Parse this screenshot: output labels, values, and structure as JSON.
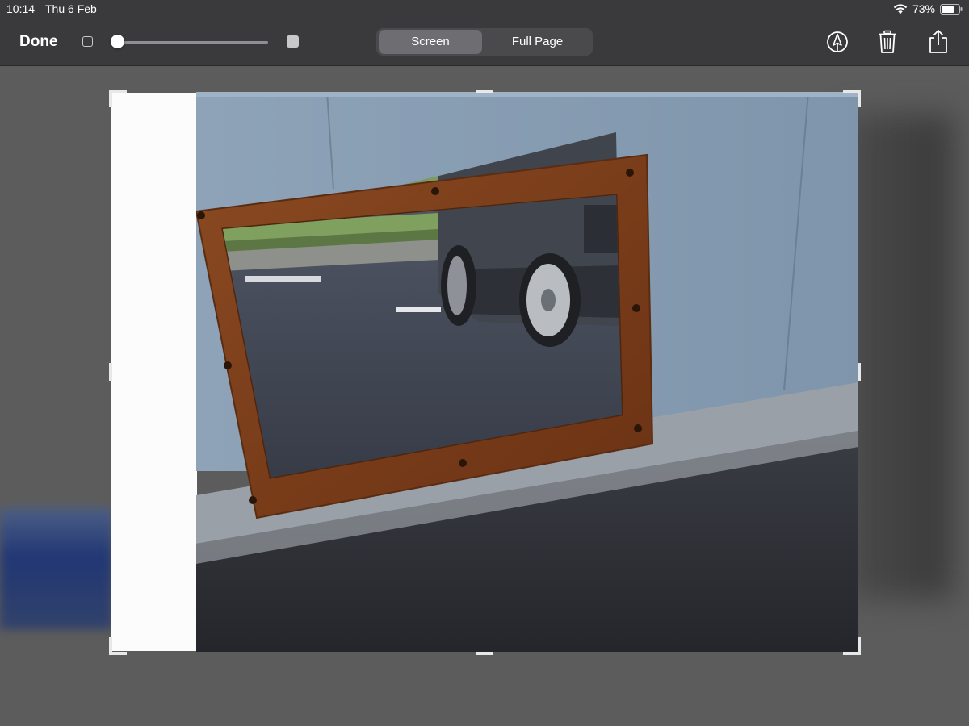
{
  "status_bar": {
    "time": "10:14",
    "date": "Thu 6 Feb",
    "battery": "73%"
  },
  "toolbar": {
    "done_label": "Done",
    "segments": [
      {
        "label": "Screen",
        "selected": true
      },
      {
        "label": "Full Page",
        "selected": false
      }
    ],
    "opacity_slider_value": 0,
    "icons": [
      "markup-pen-icon",
      "trash-icon",
      "share-icon"
    ]
  },
  "colors": {
    "toolbar_bg": "#3a3a3c",
    "canvas_bg": "#5c5c5c",
    "selected_segment": "#6e6e72"
  },
  "image": {
    "description_icon": "photo-of-wooden-framed-mirror"
  }
}
